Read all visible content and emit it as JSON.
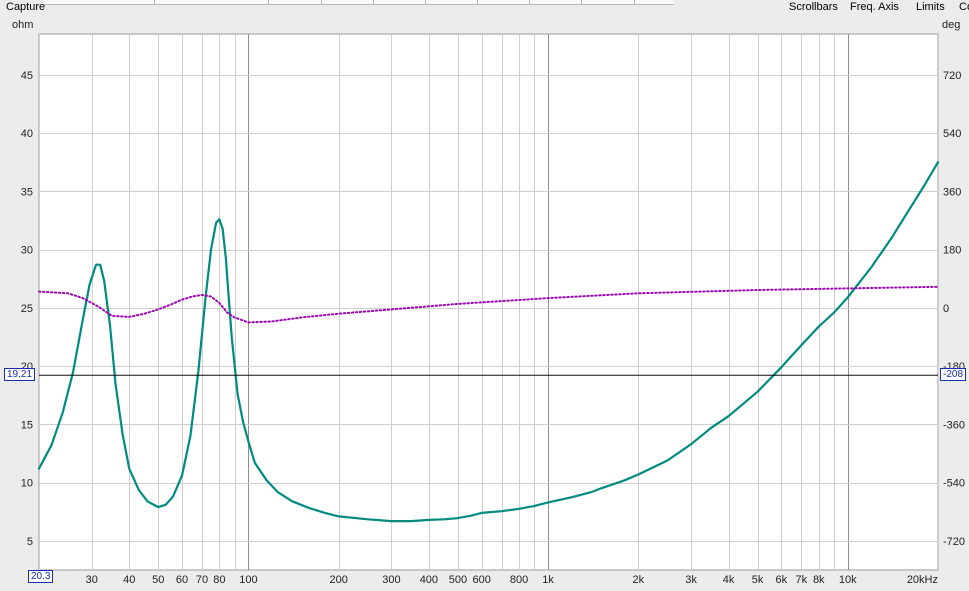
{
  "toolbar": {
    "capture_label": "Capture",
    "scrollbars_label": "Scrollbars",
    "freq_axis_label": "Freq. Axis",
    "limits_label": "Limits",
    "cut_label": "Co"
  },
  "cursor": {
    "freq_value": "20.3",
    "left_value": "19.21",
    "right_value": "-208"
  },
  "chart_data": {
    "type": "line",
    "xlabel": "",
    "x_scale": "log",
    "x_range": [
      20,
      20000
    ],
    "x_ticks": [
      {
        "v": 30,
        "label": "30"
      },
      {
        "v": 40,
        "label": "40"
      },
      {
        "v": 50,
        "label": "50"
      },
      {
        "v": 60,
        "label": "60"
      },
      {
        "v": 70,
        "label": "70"
      },
      {
        "v": 80,
        "label": "80"
      },
      {
        "v": 100,
        "label": "100"
      },
      {
        "v": 200,
        "label": "200"
      },
      {
        "v": 300,
        "label": "300"
      },
      {
        "v": 400,
        "label": "400"
      },
      {
        "v": 500,
        "label": "500"
      },
      {
        "v": 600,
        "label": "600"
      },
      {
        "v": 800,
        "label": "800"
      },
      {
        "v": 1000,
        "label": "1k"
      },
      {
        "v": 2000,
        "label": "2k"
      },
      {
        "v": 3000,
        "label": "3k"
      },
      {
        "v": 4000,
        "label": "4k"
      },
      {
        "v": 5000,
        "label": "5k"
      },
      {
        "v": 6000,
        "label": "6k"
      },
      {
        "v": 7000,
        "label": "7k"
      },
      {
        "v": 8000,
        "label": "8k"
      },
      {
        "v": 10000,
        "label": "10k"
      },
      {
        "v": 20000,
        "label": "20kHz"
      }
    ],
    "left_axis": {
      "unit": "ohm",
      "range": [
        2.5,
        48.5
      ],
      "ticks": [
        5,
        10,
        15,
        20,
        25,
        30,
        35,
        40,
        45
      ]
    },
    "right_axis": {
      "unit": "deg",
      "ticks": [
        -720,
        -540,
        -360,
        -180,
        0,
        180,
        360,
        540,
        720
      ]
    },
    "grid": true,
    "cursor_level": 19.21,
    "series": [
      {
        "axis": "left",
        "color": "#008b80",
        "style": "solid",
        "x": [
          20,
          22,
          24,
          26,
          28,
          29.5,
          31,
          32,
          33,
          34.5,
          36,
          38,
          40,
          43,
          46,
          50,
          53,
          56,
          60,
          64,
          68,
          72,
          75,
          78,
          80,
          82,
          84,
          86,
          88,
          92,
          96,
          100,
          105,
          115,
          125,
          140,
          160,
          180,
          200,
          250,
          300,
          350,
          400,
          450,
          500,
          550,
          600,
          700,
          800,
          900,
          1000,
          1200,
          1400,
          1500,
          1800,
          2000,
          2500,
          3000,
          3500,
          4000,
          5000,
          6000,
          7000,
          8000,
          9000,
          10000,
          12000,
          14000,
          16000,
          18000,
          20000
        ],
        "y": [
          11.2,
          13.2,
          16,
          19.5,
          24,
          27,
          28.7,
          28.7,
          27.3,
          23.5,
          18.5,
          14.2,
          11.2,
          9.4,
          8.4,
          7.9,
          8.1,
          8.8,
          10.6,
          14,
          19.5,
          26,
          30,
          32.3,
          32.6,
          31.8,
          29.3,
          25.8,
          22.4,
          17.6,
          15.2,
          13.5,
          11.7,
          10.2,
          9.2,
          8.4,
          7.8,
          7.4,
          7.1,
          6.85,
          6.7,
          6.7,
          6.8,
          6.85,
          6.95,
          7.15,
          7.4,
          7.55,
          7.75,
          8.0,
          8.3,
          8.75,
          9.2,
          9.5,
          10.2,
          10.7,
          11.9,
          13.3,
          14.7,
          15.7,
          17.8,
          19.9,
          21.8,
          23.4,
          24.6,
          25.9,
          28.5,
          31,
          33.4,
          35.5,
          37.5
        ]
      },
      {
        "axis": "right",
        "color": "#9a0bb0",
        "style": "dotted",
        "x": [
          20,
          25,
          28,
          30,
          32,
          35,
          40,
          45,
          50,
          55,
          60,
          65,
          70,
          75,
          80,
          85,
          90,
          100,
          120,
          150,
          200,
          300,
          500,
          1000,
          2000,
          5000,
          10000,
          20000
        ],
        "y": [
          50,
          45,
          30,
          15,
          0,
          -25,
          -28,
          -18,
          -5,
          10,
          25,
          35,
          40,
          35,
          15,
          -15,
          -30,
          -45,
          -42,
          -30,
          -18,
          -5,
          12,
          30,
          45,
          55,
          60,
          65
        ]
      }
    ]
  }
}
